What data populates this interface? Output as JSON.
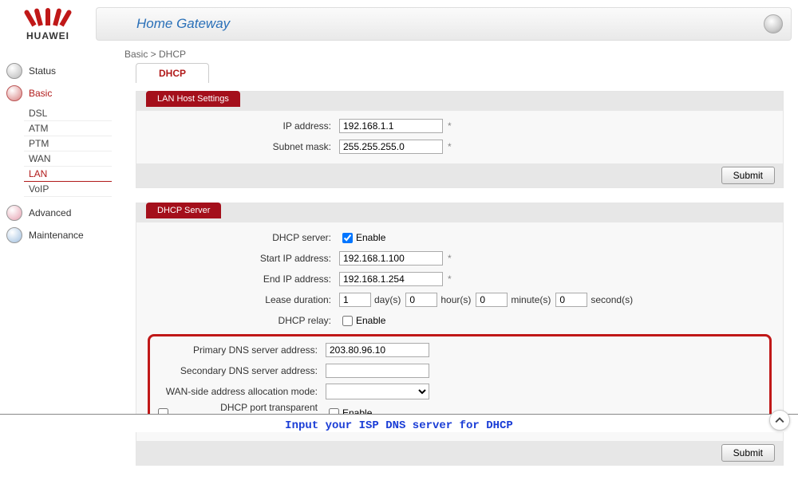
{
  "header": {
    "brand": "HUAWEI",
    "title": "Home Gateway"
  },
  "breadcrumb": "Basic > DHCP",
  "tab": {
    "label": "DHCP"
  },
  "sidebar": {
    "items": [
      {
        "label": "Status"
      },
      {
        "label": "Basic",
        "active": true
      },
      {
        "label": "Advanced"
      },
      {
        "label": "Maintenance"
      }
    ],
    "basic_sub": [
      {
        "label": "DSL"
      },
      {
        "label": "ATM"
      },
      {
        "label": "PTM"
      },
      {
        "label": "WAN"
      },
      {
        "label": "LAN",
        "active": true
      },
      {
        "label": "VoIP"
      }
    ]
  },
  "lan": {
    "panel_title": "LAN Host Settings",
    "ip_label": "IP address:",
    "ip_value": "192.168.1.1",
    "mask_label": "Subnet mask:",
    "mask_value": "255.255.255.0",
    "submit": "Submit"
  },
  "dhcp": {
    "panel_title": "DHCP Server",
    "server_label": "DHCP server:",
    "enable_text": "Enable",
    "start_label": "Start IP address:",
    "start_value": "192.168.1.100",
    "end_label": "End IP address:",
    "end_value": "192.168.1.254",
    "lease_label": "Lease duration:",
    "lease_days": "1",
    "unit_days": "day(s)",
    "lease_hours": "0",
    "unit_hours": "hour(s)",
    "lease_minutes": "0",
    "unit_minutes": "minute(s)",
    "lease_seconds": "0",
    "unit_seconds": "second(s)",
    "relay_label": "DHCP relay:",
    "primary_dns_label": "Primary DNS server address:",
    "primary_dns_value": "203.80.96.10",
    "secondary_dns_label": "Secondary DNS server address:",
    "secondary_dns_value": "",
    "wan_mode_label": "WAN-side address allocation mode:",
    "transparent_label": "DHCP port transparent transmission:",
    "submit": "Submit"
  },
  "caption": "Input your ISP DNS server for DHCP",
  "required_mark": "*"
}
